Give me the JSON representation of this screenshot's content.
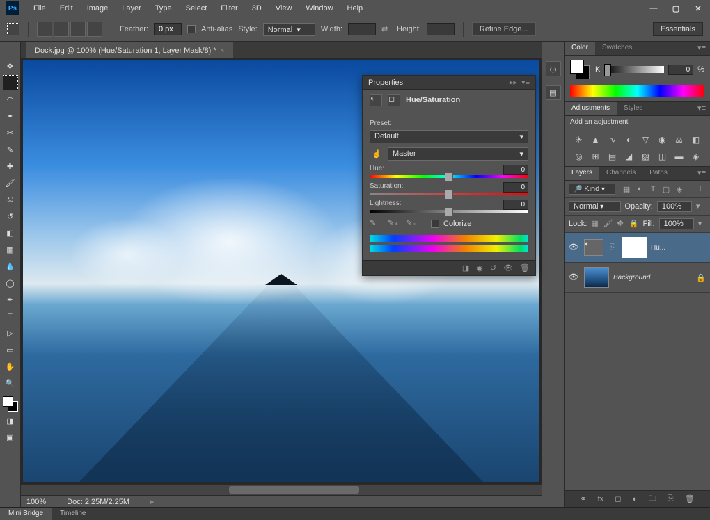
{
  "menus": [
    "File",
    "Edit",
    "Image",
    "Layer",
    "Type",
    "Select",
    "Filter",
    "3D",
    "View",
    "Window",
    "Help"
  ],
  "options_bar": {
    "feather_label": "Feather:",
    "feather_value": "0 px",
    "antialias": "Anti-alias",
    "style_label": "Style:",
    "style_value": "Normal",
    "width_label": "Width:",
    "height_label": "Height:",
    "refine": "Refine Edge...",
    "essentials": "Essentials"
  },
  "doc_tab": "Dock.jpg @ 100% (Hue/Saturation 1, Layer Mask/8) *",
  "doc_status": {
    "zoom": "100%",
    "doc_size": "Doc: 2.25M/2.25M"
  },
  "color_panel": {
    "tabs": [
      "Color",
      "Swatches"
    ],
    "channel": "K",
    "value": "0",
    "unit": "%"
  },
  "adjustments_panel": {
    "tabs": [
      "Adjustments",
      "Styles"
    ],
    "title": "Add an adjustment"
  },
  "layers_panel": {
    "tabs": [
      "Layers",
      "Channels",
      "Paths"
    ],
    "filter": "Kind",
    "blend": "Normal",
    "opacity_label": "Opacity:",
    "opacity": "100%",
    "lock_label": "Lock:",
    "fill_label": "Fill:",
    "fill": "100%",
    "items": [
      {
        "name": "Hu..."
      },
      {
        "name": "Background"
      }
    ]
  },
  "properties": {
    "title": "Properties",
    "type": "Hue/Saturation",
    "preset_label": "Preset:",
    "preset_value": "Default",
    "channel": "Master",
    "hue_label": "Hue:",
    "hue_value": "0",
    "sat_label": "Saturation:",
    "sat_value": "0",
    "light_label": "Lightness:",
    "light_value": "0",
    "colorize": "Colorize"
  },
  "bottom_tabs": [
    "Mini Bridge",
    "Timeline"
  ]
}
